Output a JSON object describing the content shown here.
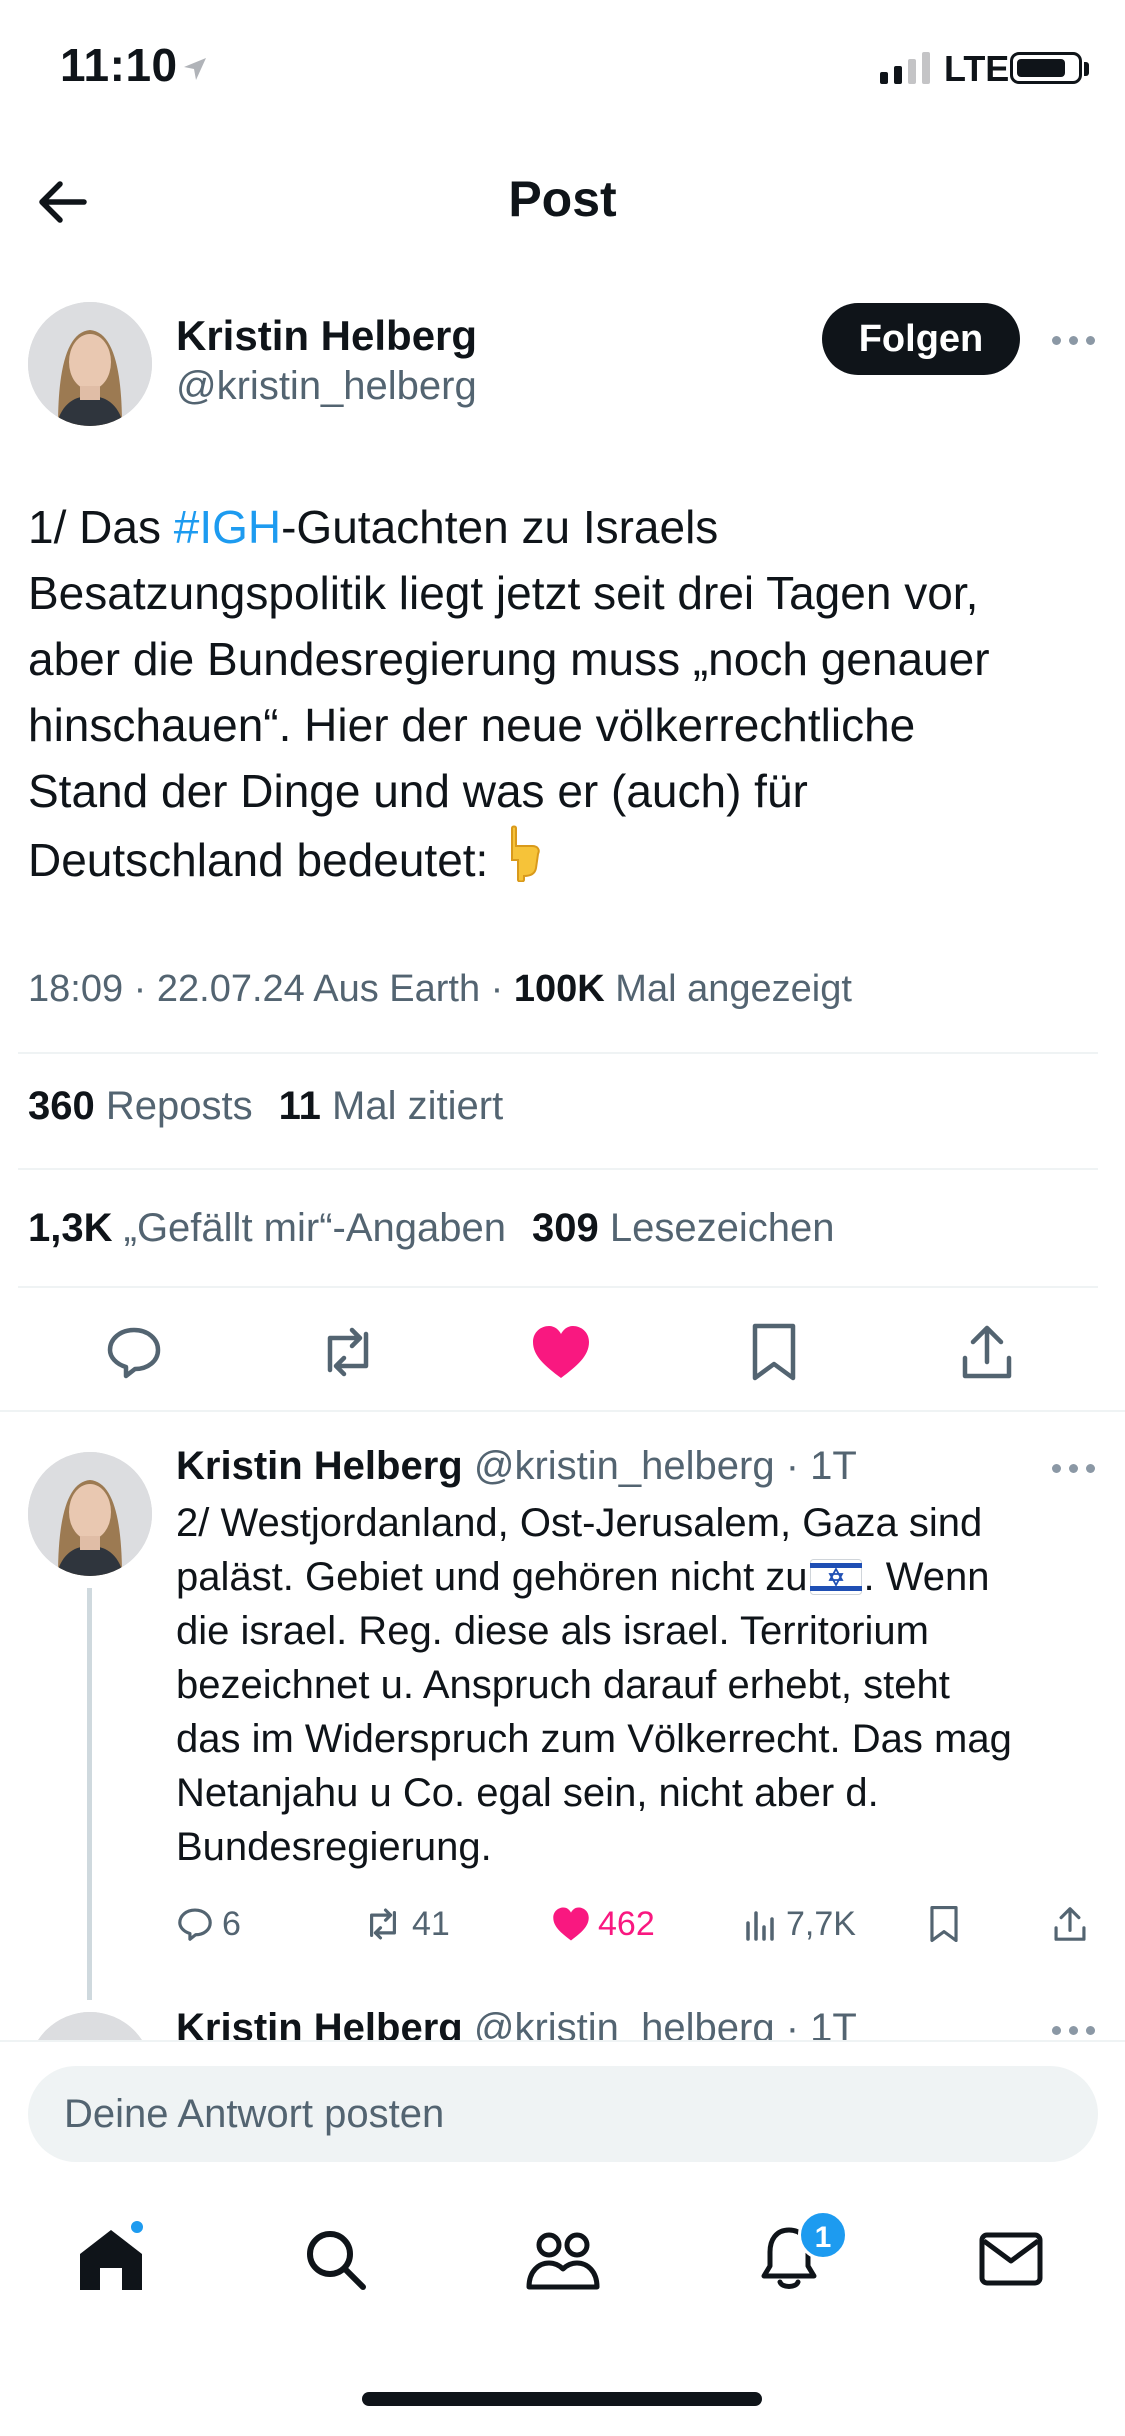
{
  "status_bar": {
    "time": "11:10",
    "network": "LTE"
  },
  "header": {
    "title": "Post",
    "back_icon": "arrow-left-icon"
  },
  "post": {
    "author_name": "Kristin Helberg",
    "author_handle": "@kristin_helberg",
    "follow_label": "Folgen",
    "text_prefix": "1/ Das ",
    "hashtag": "#IGH",
    "text_line1_rest": "-Gutachten zu Israels",
    "text_line2": "Besatzungspolitik liegt jetzt seit drei Tagen vor,",
    "text_line3": "aber die Bundesregierung muss „noch genauer",
    "text_line4": "hinschauen“. Hier der neue völkerrechtliche",
    "text_line5": "Stand der Dinge und was er (auch) für",
    "text_line6": "Deutschland bedeutet:",
    "emoji": "pointing-down-emoji",
    "meta_time": "18:09 · 22.07.24 Aus Earth ·",
    "meta_views_count": "100K",
    "meta_views_label": "Mal angezeigt",
    "reposts_count": "360",
    "reposts_label": "Reposts",
    "quotes_count": "11",
    "quotes_label": "Mal zitiert",
    "likes_count": "1,3K",
    "likes_label": "„Gefällt mir“-Angaben",
    "bookmarks_count": "309",
    "bookmarks_label": "Lesezeichen",
    "accent_color": "#1d9bf0",
    "like_color": "#f91880"
  },
  "reply": {
    "author_name": "Kristin Helberg",
    "author_handle": "@kristin_helberg · 1T",
    "line1": "2/ Westjordanland, Ost-Jerusalem, Gaza sind",
    "line2_a": "paläst. Gebiet und gehören nicht zu",
    "line2_b": ". Wenn",
    "flag": "israel-flag-emoji",
    "line3": "die israel. Reg. diese als israel. Territorium",
    "line4": "bezeichnet u. Anspruch darauf erhebt, steht",
    "line5": "das im Widerspruch zum Völkerrecht. Das mag",
    "line6": "Netanjahu u Co. egal sein, nicht aber d.",
    "line7": "Bundesregierung.",
    "replies": "6",
    "reposts": "41",
    "likes": "462",
    "views": "7,7K"
  },
  "next_reply": {
    "author_name": "Kristin Helberg",
    "author_handle": "@kristin_helberg · 1T"
  },
  "compose": {
    "placeholder": "Deine Antwort posten"
  },
  "bottom_nav": {
    "notifications_badge": "1"
  }
}
